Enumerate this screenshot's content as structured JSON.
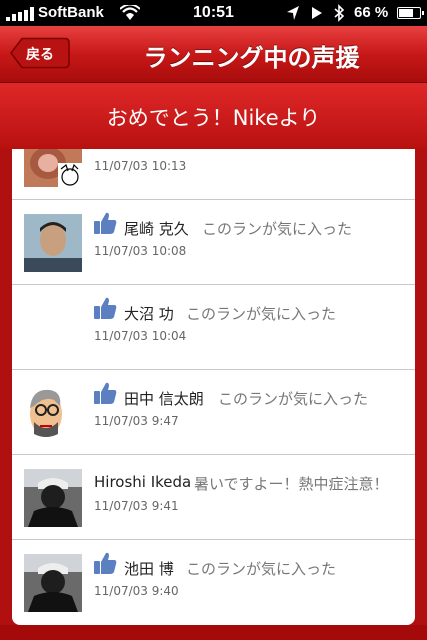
{
  "status_bar": {
    "carrier": "SoftBank",
    "time": "10:51",
    "battery": "66 %",
    "icons": [
      "signal-icon",
      "wifi-icon",
      "location-icon",
      "play-icon",
      "bluetooth-icon",
      "battery-icon"
    ]
  },
  "nav": {
    "back_label": "戻る",
    "title": "ランニング中の声援"
  },
  "banner": {
    "text": "おめでとう！Nikeより"
  },
  "feed": [
    {
      "name": "",
      "action": "",
      "timestamp": "11/07/03  10:13",
      "liked": false
    },
    {
      "name": "尾崎 克久",
      "action": "このランが気に入った",
      "timestamp": "11/07/03  10:08",
      "liked": true
    },
    {
      "name": "大沼 功",
      "action": "このランが気に入った",
      "timestamp": "11/07/03  10:04",
      "liked": true
    },
    {
      "name": "田中 信太朗",
      "action": "このランが気に入った",
      "timestamp": "11/07/03  9:47",
      "liked": true
    },
    {
      "name": "Hiroshi Ikeda",
      "action": "暑いですよー！熱中症注意！",
      "timestamp": "11/07/03  9:41",
      "liked": false
    },
    {
      "name": "池田 博",
      "action": "このランが気に入った",
      "timestamp": "11/07/03  9:40",
      "liked": true
    }
  ],
  "colors": {
    "nav_red": "#c81818",
    "like_blue": "#5b7fc0"
  }
}
